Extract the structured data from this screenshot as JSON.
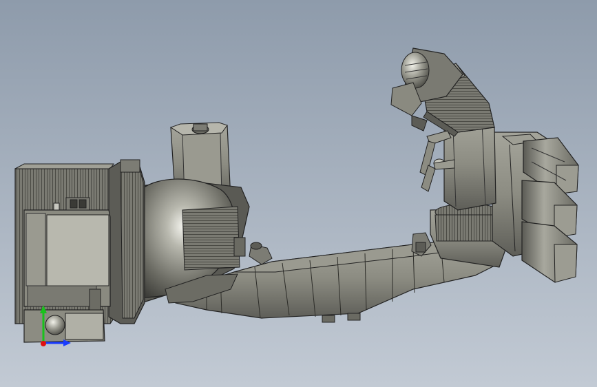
{
  "viewport": {
    "background_top": "#8e9bab",
    "background_bottom": "#c2cad4"
  },
  "model": {
    "part_color": "#8c8c82",
    "edge_color": "#222222"
  },
  "triad": {
    "x_color": "#1a3cff",
    "y_color": "#19c21c",
    "z_color": "#e01010"
  }
}
